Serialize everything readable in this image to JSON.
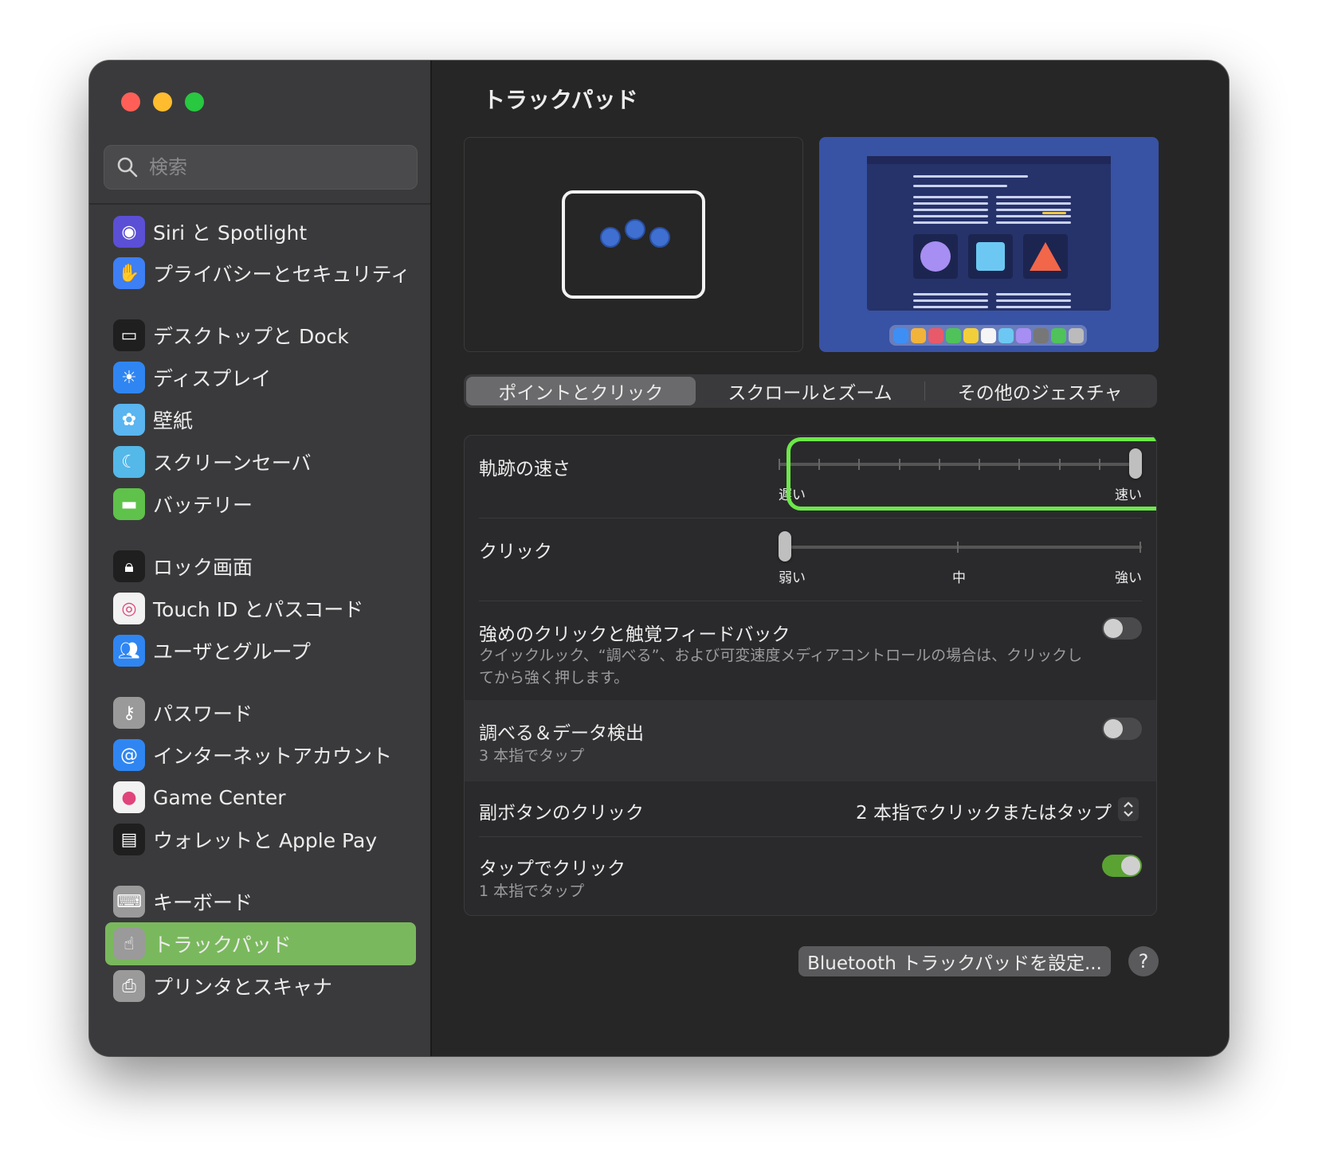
{
  "window": {
    "title": "トラックパッド"
  },
  "search": {
    "placeholder": "検索"
  },
  "sidebar": {
    "items": [
      {
        "label": "Siri と Spotlight",
        "icon": "siri-icon",
        "color": "#5b4fd6"
      },
      {
        "label": "プライバシーとセキュリティ",
        "icon": "hand-icon",
        "color": "#3d7ff5"
      },
      {
        "label": "デスクトップと Dock",
        "icon": "desktop-icon",
        "color": "#1f1f1f"
      },
      {
        "label": "ディスプレイ",
        "icon": "sun-icon",
        "color": "#2f86f2"
      },
      {
        "label": "壁紙",
        "icon": "flower-icon",
        "color": "#5ab5f0"
      },
      {
        "label": "スクリーンセーバ",
        "icon": "screensaver-icon",
        "color": "#54b8e8"
      },
      {
        "label": "バッテリー",
        "icon": "battery-icon",
        "color": "#5fc24a"
      },
      {
        "label": "ロック画面",
        "icon": "lock-icon",
        "color": "#1f1f1f"
      },
      {
        "label": "Touch ID とパスコード",
        "icon": "fingerprint-icon",
        "color": "#f2f2f2"
      },
      {
        "label": "ユーザとグループ",
        "icon": "users-icon",
        "color": "#2f86f2"
      },
      {
        "label": "パスワード",
        "icon": "key-icon",
        "color": "#9a9a9a"
      },
      {
        "label": "インターネットアカウント",
        "icon": "at-icon",
        "color": "#2f86f2"
      },
      {
        "label": "Game Center",
        "icon": "game-center-icon",
        "color": "#f2f2f2"
      },
      {
        "label": "ウォレットと Apple Pay",
        "icon": "wallet-icon",
        "color": "#1f1f1f"
      },
      {
        "label": "キーボード",
        "icon": "keyboard-icon",
        "color": "#9a9a9a"
      },
      {
        "label": "トラックパッド",
        "icon": "trackpad-icon",
        "color": "#9a9a9a",
        "selected": true
      },
      {
        "label": "プリンタとスキャナ",
        "icon": "printer-icon",
        "color": "#9a9a9a"
      }
    ],
    "accent": "#7ab85d"
  },
  "tabs": [
    {
      "label": "ポイントとクリック",
      "active": true
    },
    {
      "label": "スクロールとズーム",
      "active": false
    },
    {
      "label": "その他のジェスチャ",
      "active": false
    }
  ],
  "settings": {
    "tracking_speed": {
      "title": "軌跡の速さ",
      "min_label": "遅い",
      "max_label": "速い",
      "value_fraction": 1.0
    },
    "click": {
      "title": "クリック",
      "labels": [
        "弱い",
        "中",
        "強い"
      ],
      "value_fraction": 0.0
    },
    "force_click": {
      "title": "強めのクリックと触覚フィードバック",
      "subtitle": "クイックルック、“調べる”、および可変速度メディアコントロールの場合は、クリックしてから強く押します。",
      "enabled": false
    },
    "lookup": {
      "title": "調べる＆データ検出",
      "subtitle": "3 本指でタップ",
      "enabled": false
    },
    "secondary_click": {
      "title": "副ボタンのクリック",
      "value": "2 本指でクリックまたはタップ"
    },
    "tap_to_click": {
      "title": "タップでクリック",
      "subtitle": "1 本指でタップ",
      "enabled": true
    }
  },
  "footer": {
    "bluetooth_button": "Bluetooth トラックパッドを設定...",
    "help_label": "?"
  },
  "colors": {
    "highlight": "#6de84a",
    "toggle_on": "#5aa232"
  }
}
